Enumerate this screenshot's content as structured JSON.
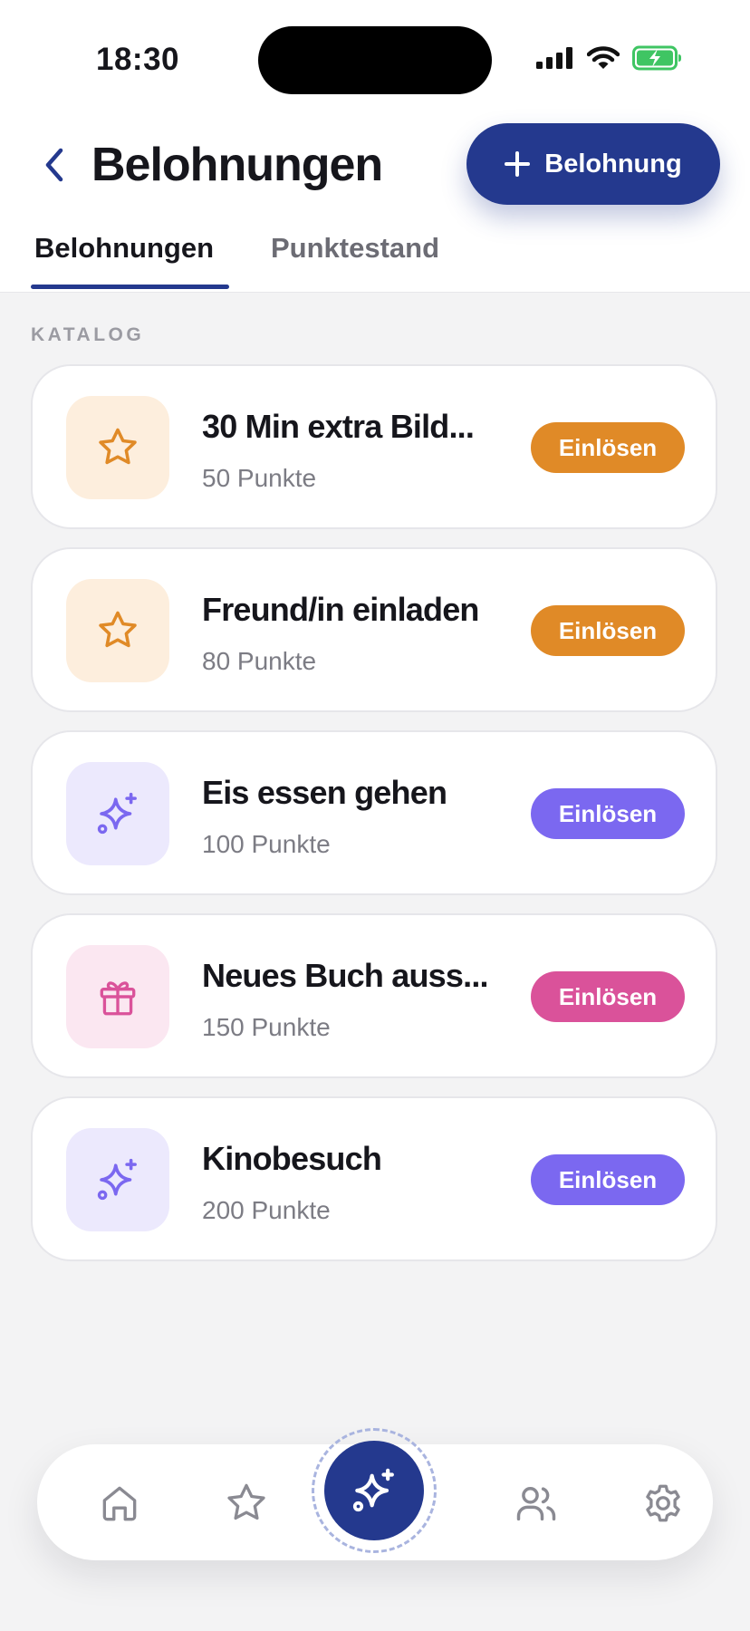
{
  "status_bar": {
    "time": "18:30",
    "icons": [
      "signal-icon",
      "wifi-icon",
      "battery-charging-icon"
    ]
  },
  "header": {
    "title": "Belohnungen",
    "back_icon": "chevron-left-icon",
    "add_button_label": "Belohnung",
    "add_icon": "plus-icon"
  },
  "tabs": [
    {
      "label": "Belohnungen",
      "active": true
    },
    {
      "label": "Punktestand",
      "active": false
    }
  ],
  "section_label": "KATALOG",
  "rewards": [
    {
      "title": "30 Min extra Bild...",
      "points": "50 Punkte",
      "icon": "star-icon",
      "button": "Einlösen",
      "accent": "#e08a27",
      "icon_bg": "#fdeedd"
    },
    {
      "title": "Freund/in einladen",
      "points": "80 Punkte",
      "icon": "star-icon",
      "button": "Einlösen",
      "accent": "#e08a27",
      "icon_bg": "#fdeedd"
    },
    {
      "title": "Eis essen gehen",
      "points": "100 Punkte",
      "icon": "sparkles-icon",
      "button": "Einlösen",
      "accent": "#7b68f0",
      "icon_bg": "#ece9fd"
    },
    {
      "title": "Neues Buch auss...",
      "points": "150 Punkte",
      "icon": "gift-icon",
      "button": "Einlösen",
      "accent": "#da529a",
      "icon_bg": "#fbe7f1"
    },
    {
      "title": "Kinobesuch",
      "points": "200 Punkte",
      "icon": "sparkles-icon",
      "button": "Einlösen",
      "accent": "#7b68f0",
      "icon_bg": "#ece9fd"
    }
  ],
  "bottom_nav": {
    "items": [
      "home-icon",
      "star-icon",
      "sparkles-icon",
      "users-icon",
      "gear-icon"
    ],
    "active": "sparkles-icon"
  },
  "colors": {
    "primary": "#24398e",
    "background": "#f3f3f4"
  }
}
